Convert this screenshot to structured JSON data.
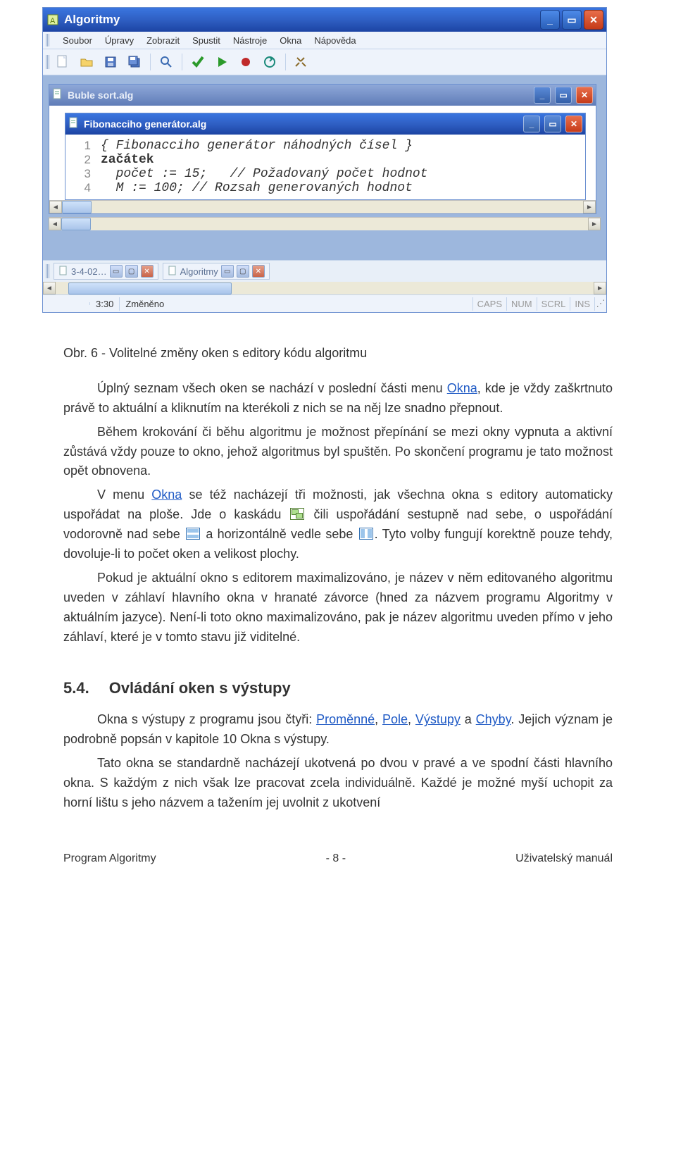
{
  "app": {
    "title": "Algoritmy",
    "menu": [
      "Soubor",
      "Úpravy",
      "Zobrazit",
      "Spustit",
      "Nástroje",
      "Okna",
      "Nápověda"
    ],
    "child_back": {
      "title": "Buble sort.alg"
    },
    "child_front": {
      "title": "Fibonacciho generátor.alg",
      "lines": [
        {
          "n": "1",
          "text": "{ Fibonacciho generátor náhodných čísel }",
          "italic": true
        },
        {
          "n": "2",
          "text": "začátek",
          "bold": true
        },
        {
          "n": "3",
          "text": "  počet := 15;   // Požadovaný počet hodnot",
          "italic": true
        },
        {
          "n": "4",
          "text": "  M := 100; // Rozsah generovaných hodnot",
          "italic": true
        }
      ]
    },
    "tabs": {
      "a": "3-4-02…",
      "b": "Algoritmy"
    },
    "status": {
      "pos": "3:30",
      "mod": "Změněno",
      "caps": "CAPS",
      "num": "NUM",
      "scrl": "SCRL",
      "ins": "INS"
    }
  },
  "doc": {
    "caption_label": "Obr. 6",
    "caption_text": "  - Volitelné změny oken s editory kódu algoritmu",
    "p1a": "Úplný seznam všech oken se nachází v poslední části menu ",
    "p1b": ", kde je vždy zaškrtnuto právě to aktuální a kliknutím na kterékoli z nich se na něj lze snadno přepnout.",
    "link_okna": "Okna",
    "p2": "Během krokování či běhu algoritmu je možnost přepínání se mezi okny vypnuta a aktivní zůstává vždy pouze to okno, jehož algoritmus byl spuštěn. Po skončení programu je tato možnost opět obnovena.",
    "p3a": "V menu ",
    "p3b": " se též nacházejí tři možnosti, jak všechna okna s editory automaticky uspořádat na ploše. Jde o kaskádu ",
    "p3c": " čili uspořádání sestupně nad sebe, o uspořádání vodorovně nad sebe ",
    "p3d": " a horizontálně vedle sebe ",
    "p3e": ". Tyto volby fungují korektně pouze tehdy, dovoluje-li to počet oken a velikost plochy.",
    "p4": "Pokud je aktuální okno s editorem maximalizováno, je název v něm editovaného algoritmu uveden v záhlaví hlavního okna v hranaté závorce (hned za názvem programu Algoritmy v aktuálním jazyce). Není-li toto okno maximalizováno, pak je název algoritmu uveden přímo v jeho záhlaví, které je v tomto stavu již viditelné.",
    "h_num": "5.4.",
    "h_text": "Ovládání oken s výstupy",
    "p5a": "Okna s výstupy z programu jsou čtyři: ",
    "p5b": ". Jejich význam je podrobně popsán v kapitole 10 Okna s výstupy.",
    "link_prom": "Proměnné",
    "link_pole": "Pole",
    "link_vys": "Výstupy",
    "link_chy": "Chyby",
    "sep_comma": ", ",
    "sep_and": " a ",
    "p6": "Tato okna se standardně nacházejí ukotvená po dvou v pravé a ve spodní části hlavního okna. S každým z nich však lze pracovat zcela individuálně. Každé je možné myší uchopit za horní lištu s jeho názvem a tažením jej uvolnit z ukotvení"
  },
  "footer": {
    "left": "Program Algoritmy",
    "center": "- 8 -",
    "right": "Uživatelský manuál"
  }
}
